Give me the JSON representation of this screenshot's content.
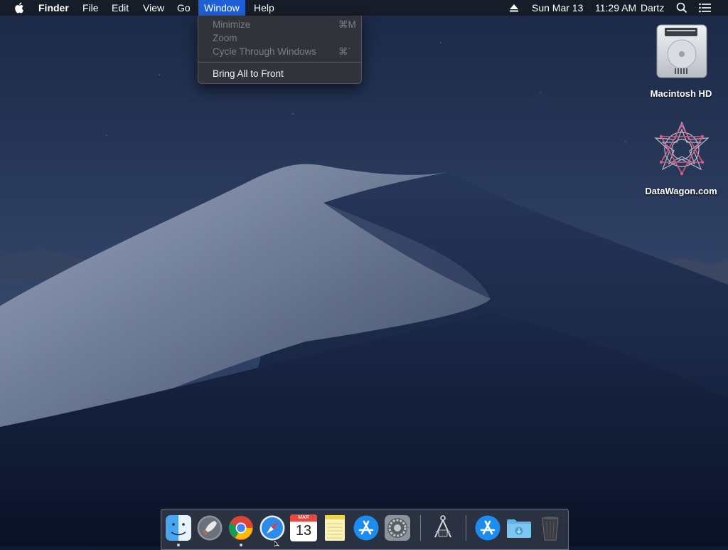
{
  "menubar": {
    "app_name": "Finder",
    "menus": [
      "File",
      "Edit",
      "View",
      "Go",
      "Window",
      "Help"
    ],
    "active_menu": "Window",
    "highlight_color": "#1f5fd6",
    "date": "Sun Mar 13",
    "time": "11:29 AM",
    "user": "Dartz",
    "icons": [
      "apple-icon",
      "eject-icon",
      "spotlight-icon",
      "notification-center-icon"
    ]
  },
  "window_menu": {
    "items": [
      {
        "label": "Minimize",
        "shortcut": "⌘M",
        "enabled": false
      },
      {
        "label": "Zoom",
        "shortcut": "",
        "enabled": false
      },
      {
        "label": "Cycle Through Windows",
        "shortcut": "⌘`",
        "enabled": false
      },
      {
        "label": "Bring All to Front",
        "shortcut": "",
        "enabled": true
      }
    ]
  },
  "desktop": {
    "icons": [
      {
        "label": "Macintosh HD",
        "icon": "hard-drive-icon"
      },
      {
        "label": "DataWagon.com",
        "icon": "star-pattern-icon"
      }
    ]
  },
  "dock": {
    "calendar_month": "MAR",
    "calendar_day": "13",
    "apps": [
      "Finder",
      "Launchpad",
      "Google Chrome",
      "Safari",
      "Calendar",
      "Notes",
      "App Store",
      "System Preferences",
      "Directory Utility",
      "App Store",
      "Downloads",
      "Trash"
    ],
    "running": [
      "Finder",
      "Google Chrome"
    ]
  }
}
